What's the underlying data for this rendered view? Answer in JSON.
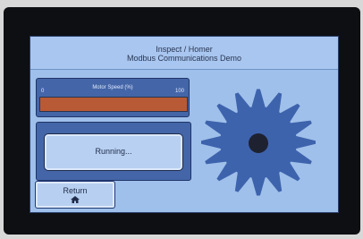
{
  "screen": {
    "title_line1": "Inspect / Homer",
    "title_line2": "Modbus Communications Demo"
  },
  "motor_speed": {
    "label": "Motor Speed (%)",
    "min_label": "0",
    "max_label": "100",
    "value_percent": 100
  },
  "status": {
    "text": "Running..."
  },
  "return_button": {
    "label": "Return",
    "icon": "home-icon"
  },
  "colors": {
    "screen_bg": "#9fc0ea",
    "panel": "#4466a8",
    "meter_fill": "#b85a35",
    "gear": "#3e63ad"
  }
}
